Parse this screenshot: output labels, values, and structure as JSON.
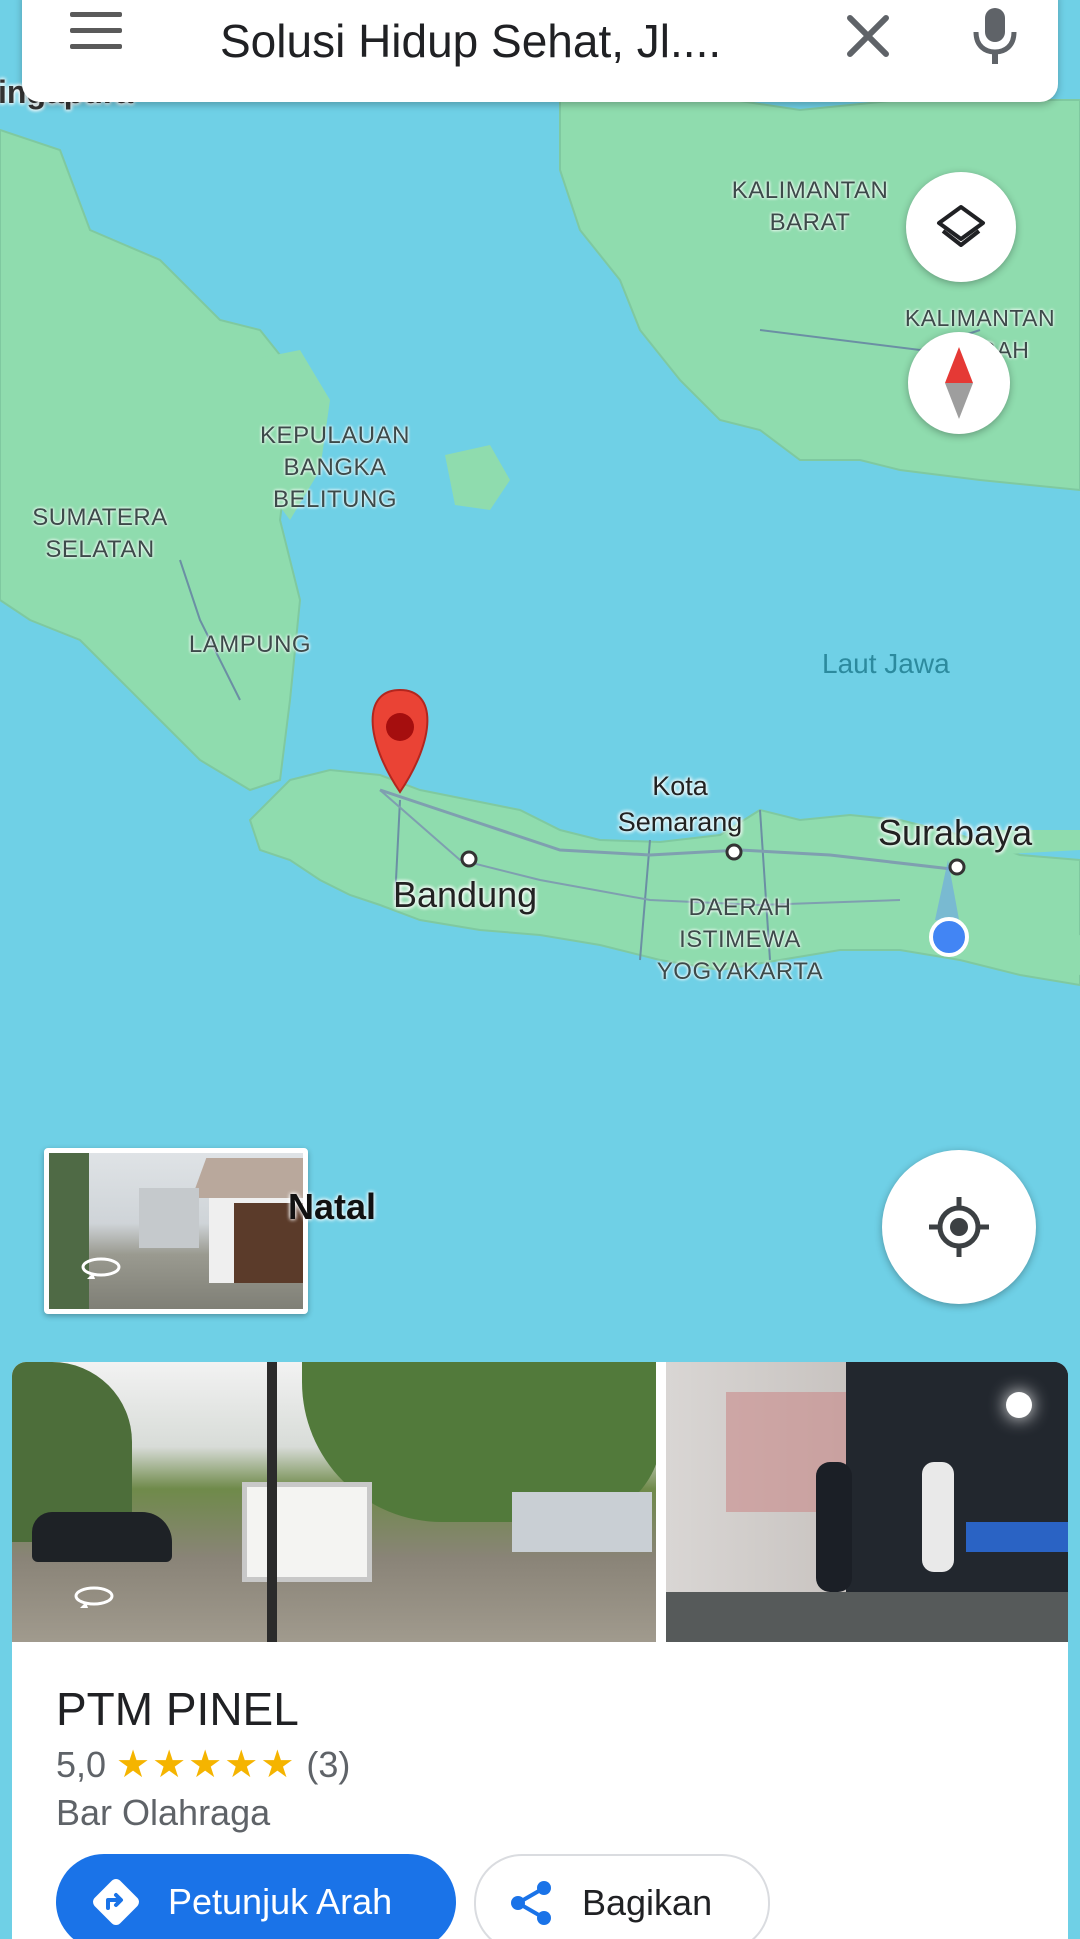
{
  "search": {
    "query": "Solusi Hidup Sehat, Jl...."
  },
  "map": {
    "regions": [
      {
        "id": "kalbar",
        "label": "KALIMANTAN\nBARAT"
      },
      {
        "id": "kalteng",
        "label": "KALIMANTAN\nTENGAH"
      },
      {
        "id": "babel",
        "label": "KEPULAUAN\nBANGKA\nBELITUNG"
      },
      {
        "id": "sumsel",
        "label": "SUMATERA\nSELATAN"
      },
      {
        "id": "lampung",
        "label": "LAMPUNG"
      },
      {
        "id": "diy",
        "label": "DAERAH\nISTIMEWA\nYOGYAKARTA"
      }
    ],
    "sea": "Laut Jawa",
    "cities": {
      "bandung": "Bandung",
      "semarang": "Kota\nSemarang",
      "surabaya": "Surabaya",
      "singapura": "ingapura"
    },
    "street_view_caption": "Natal"
  },
  "place": {
    "name": "PTM PINEL",
    "rating": "5,0",
    "stars": "★★★★★",
    "reviews": "(3)",
    "category": "Bar Olahraga"
  },
  "actions": {
    "directions": "Petunjuk Arah",
    "share": "Bagikan"
  },
  "colors": {
    "sea": "#6fd0e6",
    "land": "#8fdcae",
    "pin": "#e53935",
    "primary": "#1a73e8",
    "star": "#f5b400"
  }
}
